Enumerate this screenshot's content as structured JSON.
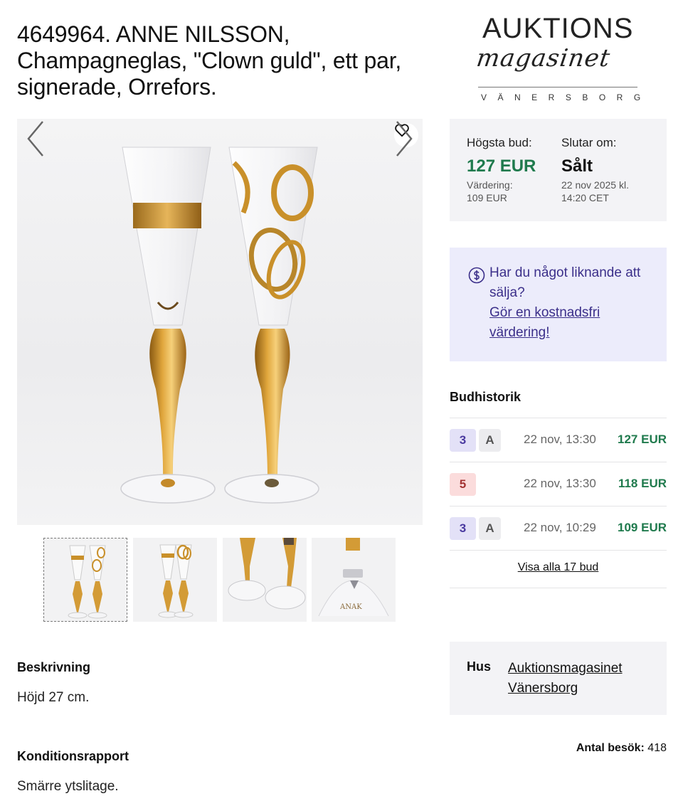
{
  "title": "4649964. ANNE NILSSON, Champagneglas, \"Clown guld\", ett par, signerade, Orrefors.",
  "logo": {
    "top": "AUKTIONS",
    "script": "magasinet",
    "city": "VÄNERSBORG"
  },
  "gallery": {
    "favorite_icon": "heart-icon",
    "prev_icon": "chevron-left-icon",
    "next_icon": "chevron-right-icon",
    "thumbnail_count": 4,
    "active_thumbnail": 0
  },
  "bid": {
    "highest_label": "Högsta bud:",
    "highest_value": "127 EUR",
    "valuation": "Värdering:\n109 EUR",
    "ends_label": "Slutar om:",
    "ends_value": "Sålt",
    "ends_date": "22 nov 2025 kl.\n14:20 CET"
  },
  "sell": {
    "icon": "dollar-circle-icon",
    "question": "Har du något liknande att sälja?",
    "link": "Gör en kostnadsfri värdering!"
  },
  "bid_history": {
    "title": "Budhistorik",
    "rows": [
      {
        "bidder": "3",
        "flag": "A",
        "time": "22 nov, 13:30",
        "amount": "127 EUR",
        "color": "purple"
      },
      {
        "bidder": "5",
        "flag": "",
        "time": "22 nov, 13:30",
        "amount": "118 EUR",
        "color": "red"
      },
      {
        "bidder": "3",
        "flag": "A",
        "time": "22 nov, 10:29",
        "amount": "109 EUR",
        "color": "purple"
      }
    ],
    "view_all": "Visa alla 17 bud"
  },
  "description": {
    "heading": "Beskrivning",
    "text": "Höjd 27 cm."
  },
  "condition": {
    "heading": "Konditionsrapport",
    "text": "Smärre ytslitage."
  },
  "house": {
    "label": "Hus",
    "value": "Auktionsmagasinet Vänersborg"
  },
  "visits": {
    "label": "Antal besök:",
    "value": "418"
  },
  "colors": {
    "accent_green": "#1f7a4d",
    "sell_text": "#3b2f8a",
    "sell_bg": "#ececfb",
    "gold": "#c9902a"
  }
}
